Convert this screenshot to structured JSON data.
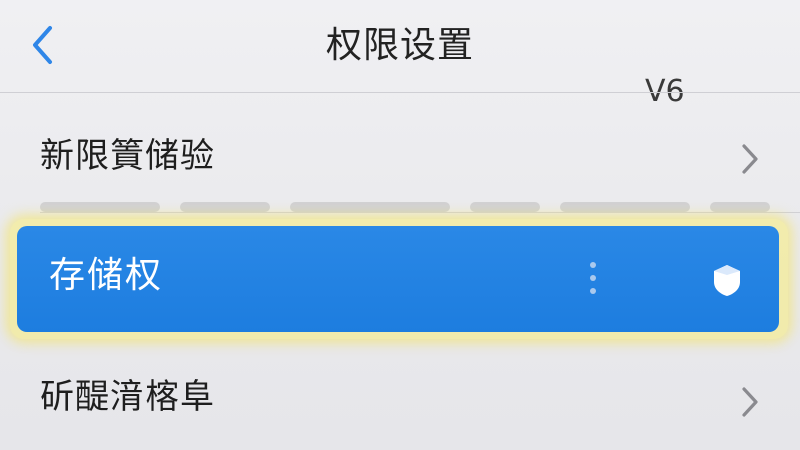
{
  "header": {
    "title": "权限设置",
    "back_icon": "chevron-left-icon"
  },
  "version_label": "V6",
  "rows": [
    {
      "label": "新限篢储验",
      "icon": "chevron-right-icon"
    },
    {
      "label": "存储权",
      "selected": true,
      "handle_icon": "drag-handle-icon",
      "action_icon": "shield-icon"
    },
    {
      "label": "斫醍湇楁阜",
      "icon": "chevron-right-icon"
    }
  ],
  "colors": {
    "accent": "#1f7fe0",
    "highlight_glow": "#f2e26a",
    "background": "#ececef",
    "back_arrow": "#2f86e8"
  }
}
